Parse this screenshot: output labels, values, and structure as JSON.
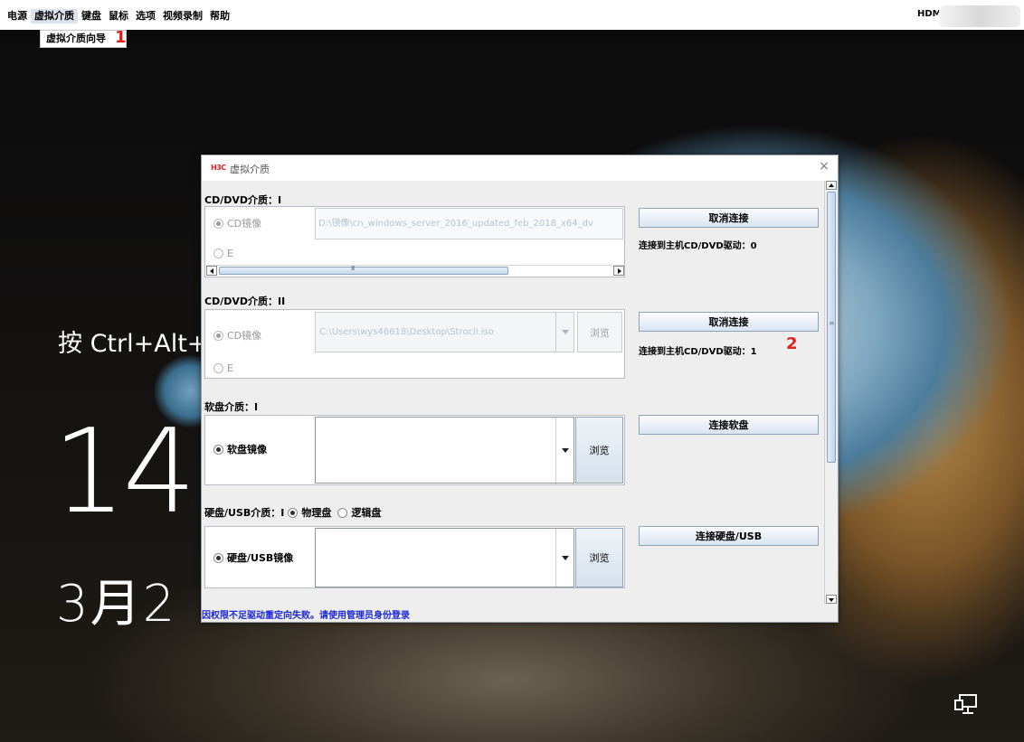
{
  "menubar": {
    "items": [
      "电源",
      "虚拟介质",
      "键盘",
      "鼠标",
      "选项",
      "视频录制",
      "帮助"
    ],
    "hdm_ip_label": "HDM IP"
  },
  "dropdown": {
    "item": "虚拟介质向导"
  },
  "annotations": {
    "marker_1": "1",
    "marker_2": "2"
  },
  "lockscreen": {
    "hint": "按 Ctrl+Alt+",
    "time": "14",
    "date": "3月2"
  },
  "dialog": {
    "logo": "H3C",
    "title": "虚拟介质",
    "close": "×",
    "cd1": {
      "title": "CD/DVD介质：I",
      "opt_image": "CD镜像",
      "opt_drive": "E",
      "path": "D:\\镜像\\cn_windows_server_2016_updated_feb_2018_x64_dv",
      "button": "取消连接",
      "status": "连接到主机CD/DVD驱动：0"
    },
    "cd2": {
      "title": "CD/DVD介质：II",
      "opt_image": "CD镜像",
      "opt_drive": "E",
      "path": "C:\\Users\\wys46618\\Desktop\\Strocli.iso",
      "browse": "浏览",
      "button": "取消连接",
      "status": "连接到主机CD/DVD驱动：1"
    },
    "floppy": {
      "title": "软盘介质：I",
      "opt_image": "软盘镜像",
      "browse": "浏览",
      "button": "连接软盘"
    },
    "hdd": {
      "title": "硬盘/USB介质：I",
      "opt_physical": "物理盘",
      "opt_logical": "逻辑盘",
      "opt_image": "硬盘/USB镜像",
      "browse": "浏览",
      "button": "连接硬盘/USB"
    },
    "status_message": "因权限不足驱动重定向失败。请使用管理员身份登录"
  }
}
